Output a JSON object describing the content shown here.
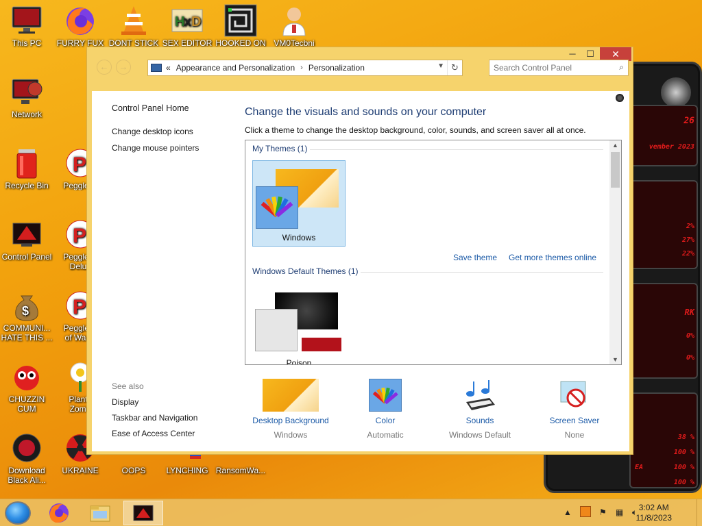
{
  "desktop": {
    "icons": [
      {
        "label": "This PC"
      },
      {
        "label": "FURRY FUX"
      },
      {
        "label": "DONT STICK"
      },
      {
        "label": "SEX EDITOR"
      },
      {
        "label": "HOOKED ON"
      },
      {
        "label": "VM0Tecbni"
      },
      {
        "label": "Network"
      },
      {
        "label": "Recycle Bin"
      },
      {
        "label": "Peggle D"
      },
      {
        "label": "Control Panel"
      },
      {
        "label": "Peggle N",
        "label2": "Delux"
      },
      {
        "label": "COMMUNI...",
        "label2": "HATE THIS ..."
      },
      {
        "label": "Peggle V",
        "label2": "of Warcr"
      },
      {
        "label": "CHUZZIN",
        "label2": "CUM"
      },
      {
        "label": "Plants",
        "label2": "Zomb"
      },
      {
        "label": "Download",
        "label2": "Black Ali..."
      },
      {
        "label": "UKRAINE"
      },
      {
        "label": "OOPS"
      },
      {
        "label": "LYNCHING"
      },
      {
        "label": "RansomWa..."
      }
    ]
  },
  "gadget": {
    "lines": [
      "26",
      "vember 2023",
      "2%",
      "27%",
      "22%",
      "RK",
      "0%",
      "0%",
      "38 %",
      "100 %",
      "EA",
      "100 %",
      "100 %"
    ]
  },
  "window": {
    "address": {
      "chevrons": "«",
      "crumbs": [
        "Appearance and Personalization",
        "Personalization"
      ]
    },
    "search_placeholder": "Search Control Panel",
    "left_nav": {
      "home": "Control Panel Home",
      "links": [
        "Change desktop icons",
        "Change mouse pointers"
      ]
    },
    "see_also": {
      "header": "See also",
      "links": [
        "Display",
        "Taskbar and Navigation",
        "Ease of Access Center"
      ]
    },
    "title": "Change the visuals and sounds on your computer",
    "subtitle": "Click a theme to change the desktop background, color, sounds, and screen saver all at once.",
    "themes": {
      "my_themes_header": "My Themes (1)",
      "my_theme_name": "Windows",
      "save_theme": "Save theme",
      "get_more": "Get more themes online",
      "default_header": "Windows Default Themes (1)",
      "default_theme_name": "Poison"
    },
    "bottom": [
      {
        "title": "Desktop Background",
        "value": "Windows"
      },
      {
        "title": "Color",
        "value": "Automatic"
      },
      {
        "title": "Sounds",
        "value": "Windows Default"
      },
      {
        "title": "Screen Saver",
        "value": "None"
      }
    ]
  },
  "taskbar": {
    "time": "3:02 AM",
    "date": "11/8/2023"
  },
  "colors": {
    "accent_link": "#1e5ca8",
    "title_blue": "#1e3d73",
    "close_red": "#c7413b",
    "window_frame": "#f6d36c"
  }
}
